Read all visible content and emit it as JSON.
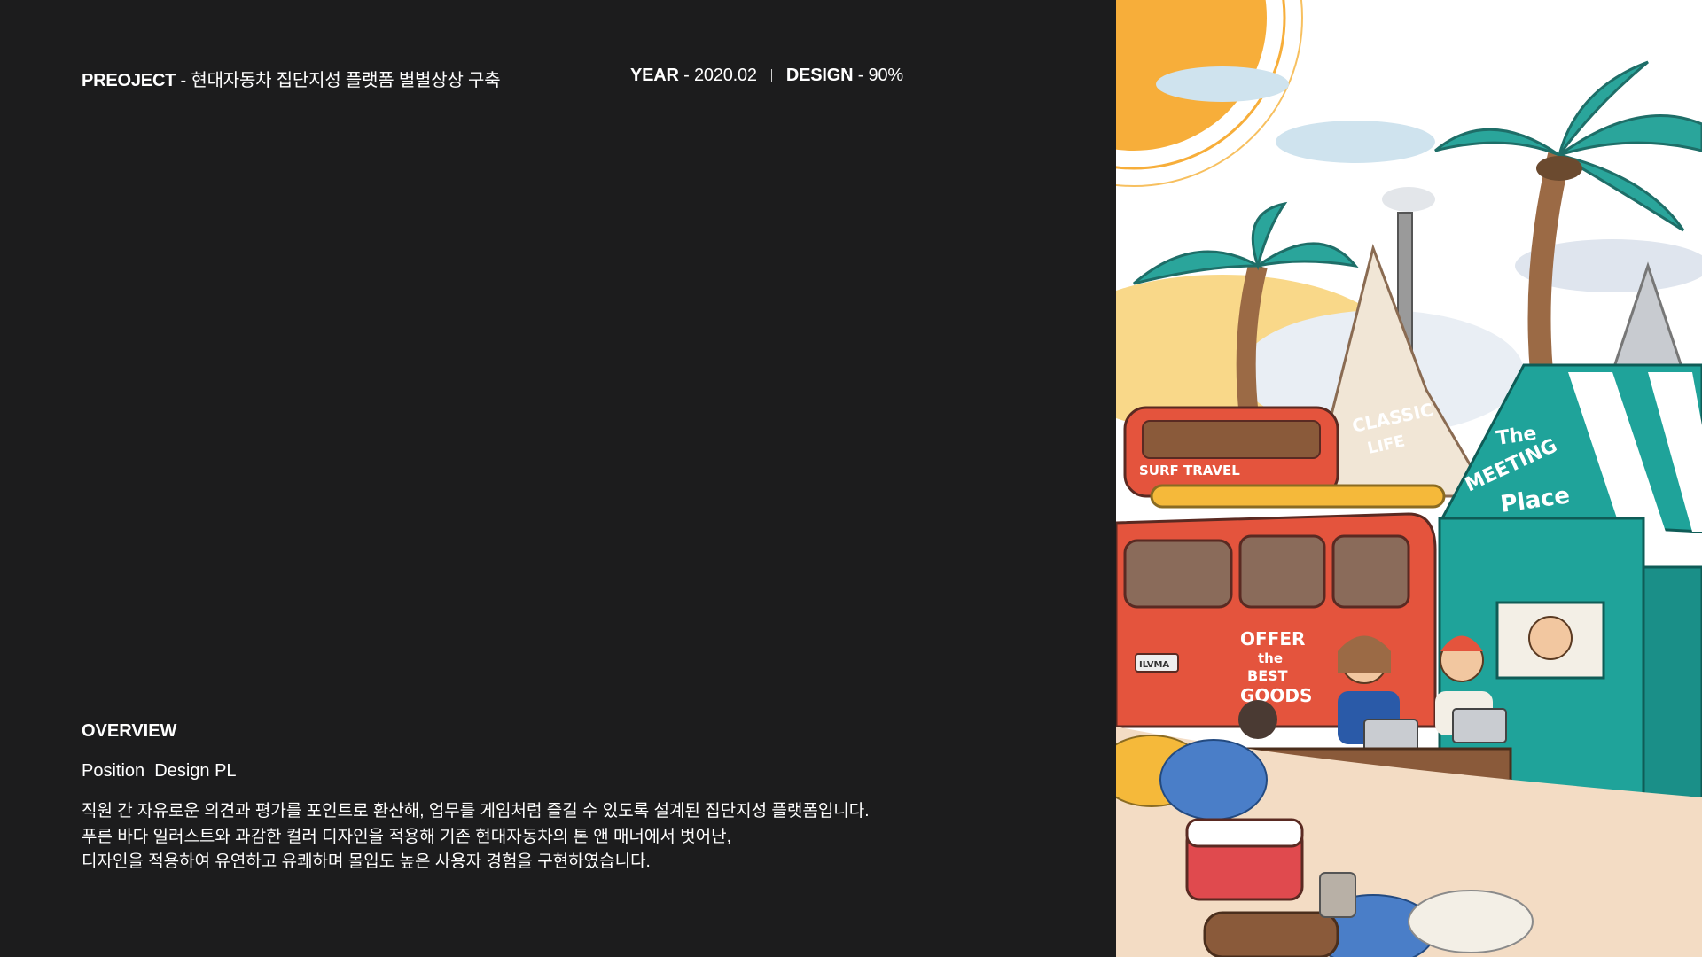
{
  "header": {
    "project_key": "PREOJECT",
    "project_value": " - 현대자동차 집단지성 플랫폼 별별상상 구축",
    "year_key": "YEAR",
    "year_value": " - 2020.02",
    "design_key": "DESIGN",
    "design_value": " - 90%"
  },
  "overview": {
    "heading": "OVERVIEW",
    "position_label": "Position",
    "position_value": "Design PL",
    "description_lines": [
      "직원 간 자유로운 의견과 평가를 포인트로 환산해, 업무를 게임처럼 즐길 수 있도록 설계된 집단지성 플랫폼입니다.",
      "푸른 바다 일러스트와 과감한 컬러 디자인을 적용해 기존 현대자동차의 톤 앤 매너에서 벗어난,",
      "디자인을 적용하여  유연하고 유쾌하며 몰입도 높은 사용자 경험을 구현하였습니다."
    ]
  },
  "illustration": {
    "van_top_label": "SURF TRAVEL",
    "tent_label_1": "CLASSIC",
    "tent_label_2": "LIFE",
    "booth_label_1": "The",
    "booth_label_2": "MEETING",
    "booth_label_3": "Place",
    "van_text_1": "OFFER",
    "van_text_2": "the",
    "van_text_3": "BEST",
    "van_text_4": "GOODS",
    "plate_text": "ILVMA",
    "colors": {
      "background": "#1c1c1d",
      "teal": "#1fa39a",
      "van_red": "#e4543d",
      "sun": "#f7ae3a",
      "wood": "#8a5a3a"
    }
  }
}
